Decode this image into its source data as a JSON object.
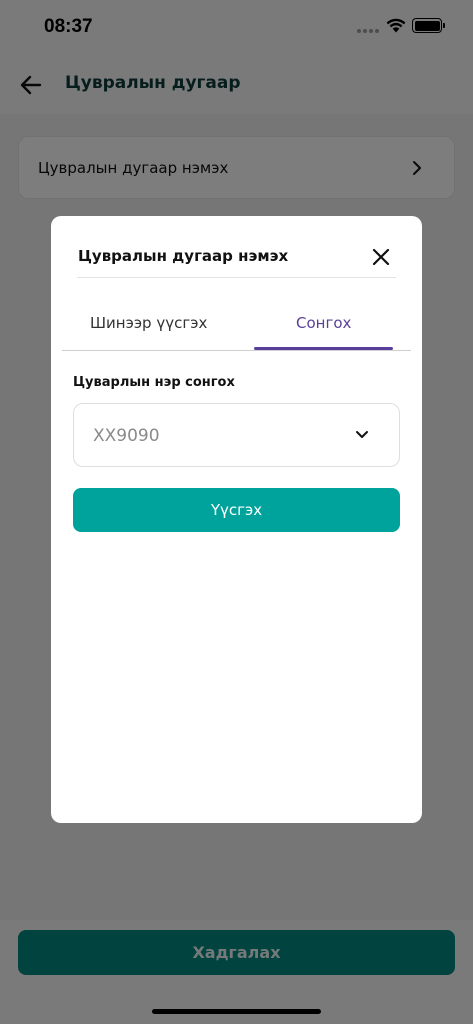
{
  "status_bar": {
    "time": "08:37"
  },
  "app_bar": {
    "title": "Цувралын дугаар"
  },
  "list": {
    "item_label": "Цувралын дугаар нэмэх"
  },
  "footer": {
    "save_label": "Хадгалах"
  },
  "modal": {
    "title": "Цувралын дугаар нэмэх",
    "tabs": [
      {
        "label": "Шинээр үүсгэх",
        "active": false
      },
      {
        "label": "Сонгох",
        "active": true
      }
    ],
    "field_label": "Цуварлын нэр сонгох",
    "select_value": "XX9090",
    "create_label": "Үүсгэх"
  },
  "colors": {
    "accent": "#00a39b",
    "accent_dark": "#00867f",
    "tab_active": "#5a3f9a",
    "title_color": "#0e3b3a"
  },
  "icons": [
    "back-arrow-icon",
    "chevron-right-icon",
    "close-icon",
    "chevron-down-icon",
    "wifi-icon",
    "battery-icon",
    "signal-icon"
  ]
}
